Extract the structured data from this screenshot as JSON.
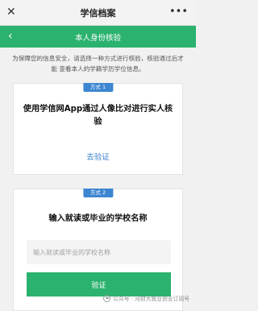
{
  "window": {
    "title": "学信档案",
    "close_glyph": "✕",
    "more_glyph": "•••"
  },
  "navbar": {
    "title": "本人身份核验",
    "back_glyph": "‹"
  },
  "notice": "为保障您的信息安全，请选择一种方式进行核验，核验通过后才能 查看本人的学籍学历学位信息。",
  "method1": {
    "badge": "方式 1",
    "heading": "使用学信网App通过人像比对进行实人核验",
    "link": "去验证"
  },
  "method2": {
    "badge": "方式 2",
    "heading": "输入就读或毕业的学校名称",
    "input_value": "",
    "input_placeholder": "输入就读或毕业的学校名称",
    "button": "验证"
  },
  "watermark": "公众号 · 河财大就业创业订阅号",
  "colors": {
    "brand_green": "#2bb26e",
    "badge_blue": "#3d86d1",
    "link_blue": "#3b82c8"
  }
}
